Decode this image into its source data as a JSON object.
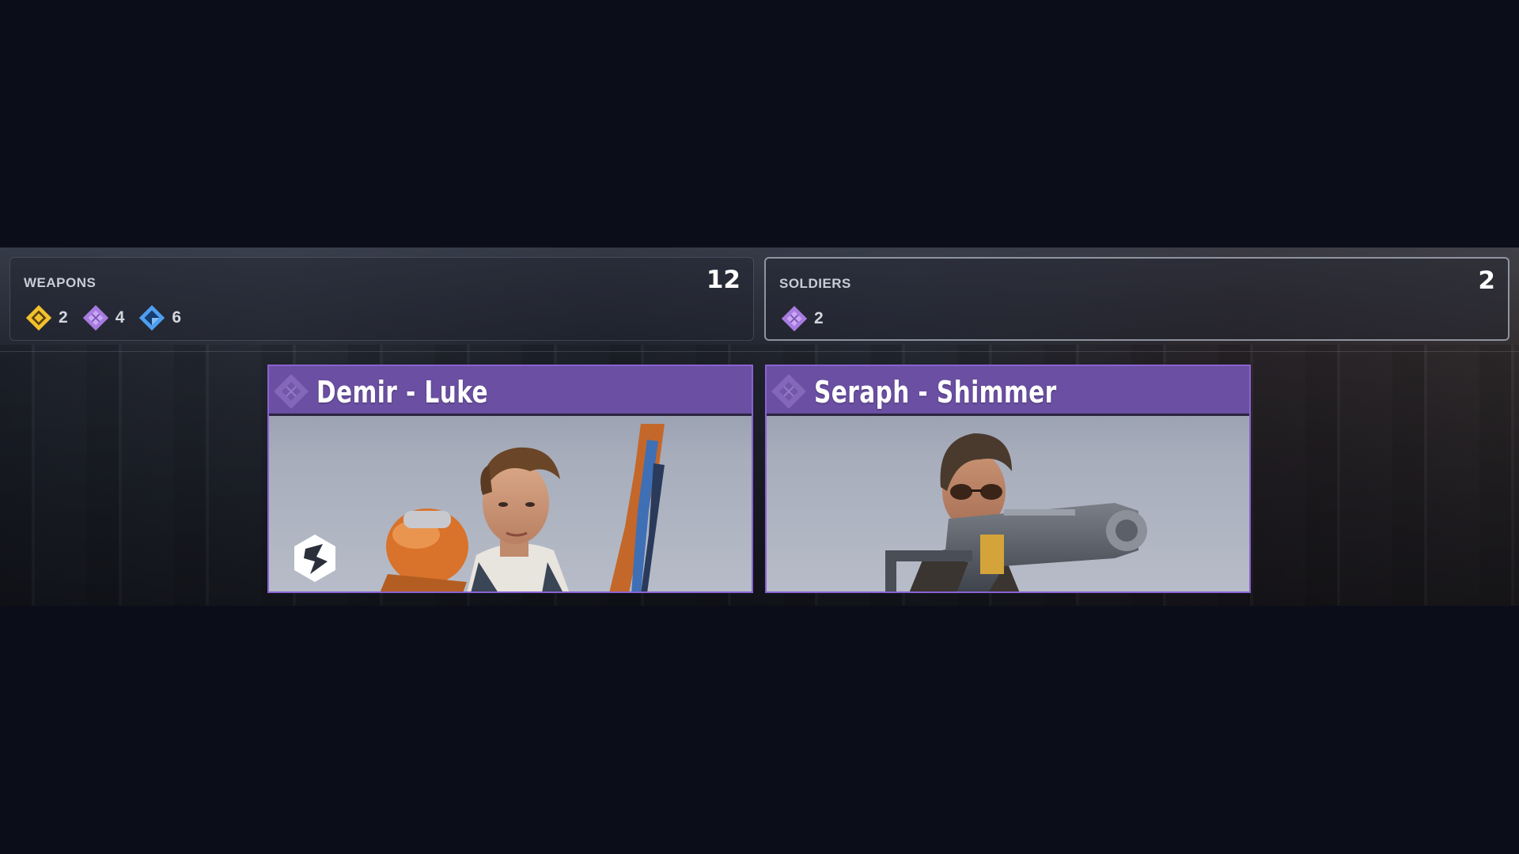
{
  "summary": {
    "weapons": {
      "label": "WEAPONS",
      "total": "12",
      "rarities": [
        {
          "icon": "gold-diamond-icon",
          "color": "#f2c12e",
          "count": "2"
        },
        {
          "icon": "purple-diamond-icon",
          "color": "#a77be0",
          "count": "4"
        },
        {
          "icon": "blue-diamond-icon",
          "color": "#4e9ff0",
          "count": "6"
        }
      ]
    },
    "soldiers": {
      "label": "SOLDIERS",
      "total": "2",
      "rarities": [
        {
          "icon": "purple-diamond-icon",
          "color": "#a77be0",
          "count": "2"
        }
      ]
    }
  },
  "cards": [
    {
      "title": "Demir - Luke",
      "rarity": "purple",
      "icon": "rarity-diamond-icon",
      "badge_icon": "faction-logo-icon"
    },
    {
      "title": "Seraph - Shimmer",
      "rarity": "purple",
      "icon": "rarity-diamond-icon"
    }
  ],
  "colors": {
    "rarity_purple": "#6a4fa2",
    "card_border": "#8a63d2",
    "background": "#0b0e18"
  }
}
